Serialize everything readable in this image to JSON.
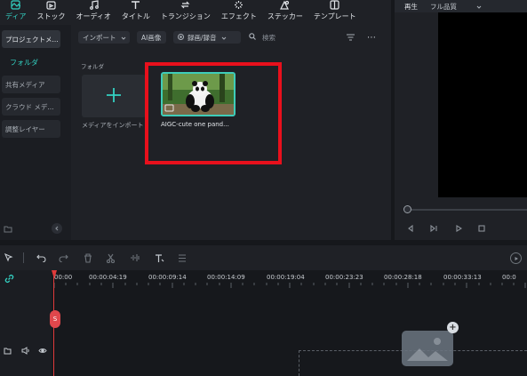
{
  "toolbar": {
    "items": [
      {
        "label": "ディア",
        "icon": "media-icon"
      },
      {
        "label": "ストック",
        "icon": "stock-icon"
      },
      {
        "label": "オーディオ",
        "icon": "music-icon"
      },
      {
        "label": "タイトル",
        "icon": "title-icon"
      },
      {
        "label": "トランジション",
        "icon": "transition-icon"
      },
      {
        "label": "エフェクト",
        "icon": "effect-icon"
      },
      {
        "label": "ステッカー",
        "icon": "sticker-icon"
      },
      {
        "label": "テンプレート",
        "icon": "template-icon"
      }
    ]
  },
  "sidebar": {
    "project_media": "プロジェクトメ...",
    "folder": "フォルダ",
    "shared_media": "共有メディア",
    "cloud_media": "クラウド メデ...",
    "adjustment_layer": "調整レイヤー"
  },
  "media_toolbar": {
    "import": "インポート",
    "ai_image": "AI画像",
    "record": "録画/録音",
    "search_placeholder": "検索"
  },
  "media": {
    "folder_label": "フォルダ",
    "import_label": "メディアをインポート",
    "clip_name": "AIGC-cute one pand..."
  },
  "preview": {
    "tab_play": "再生",
    "quality": "フル品質"
  },
  "timeline": {
    "timecodes": [
      "00:00",
      "00:00:04:19",
      "00:00:09:14",
      "00:00:14:09",
      "00:00:19:04",
      "00:00:23:23",
      "00:00:28:18",
      "00:00:33:13",
      "00:0"
    ],
    "playhead_badge": "S"
  },
  "colors": {
    "accent": "#33d1c2",
    "highlight_box": "#e8101c",
    "playhead": "#e03a3a"
  }
}
